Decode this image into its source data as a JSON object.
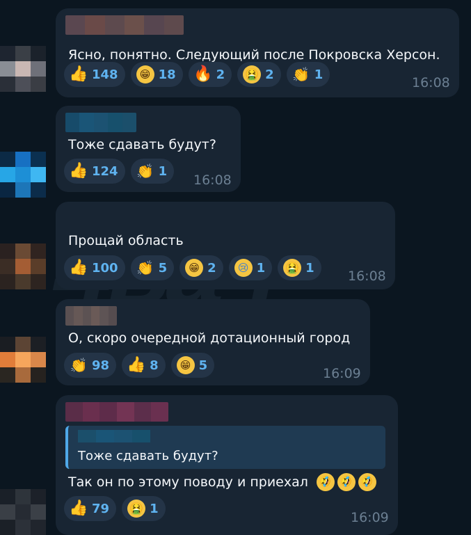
{
  "watermark": "4вач",
  "messages": [
    {
      "text": "Ясно, понятно. Следующий после Покровска Херсон.",
      "time": "16:08",
      "sender_colors": [
        "#5a4750",
        "#6a4a48",
        "#5d4a4e",
        "#6b504b",
        "#574650",
        "#5e4a4d"
      ],
      "avatar_colors": [
        "#1e2530",
        "#3a3f46",
        "#1b222b",
        "#8a8e95",
        "#c9b7b3",
        "#6e7079",
        "#2a2f38",
        "#4d4f58",
        "#3a3d44"
      ],
      "reactions": [
        {
          "icon": "thumbs-up-icon",
          "kind": "thumb",
          "count": "148"
        },
        {
          "icon": "grin-icon",
          "kind": "grin",
          "count": "18"
        },
        {
          "icon": "fire-icon",
          "kind": "fire",
          "count": "2"
        },
        {
          "icon": "vomit-icon",
          "kind": "vomit",
          "count": "2"
        },
        {
          "icon": "clap-icon",
          "kind": "clap",
          "count": "1"
        }
      ]
    },
    {
      "text": "Тоже сдавать будут?",
      "time": "16:08",
      "sender_colors": [
        "#174b6a",
        "#1a5577",
        "#1c5272",
        "#17506c",
        "#1b4f6b"
      ],
      "avatar_colors": [
        "#0c2a45",
        "#1770c2",
        "#0b3050",
        "#27a6e6",
        "#1d8fd6",
        "#3fb7f2",
        "#0a2642",
        "#1d76b8",
        "#0c2c4a"
      ],
      "reactions": [
        {
          "icon": "thumbs-up-icon",
          "kind": "thumb",
          "count": "124"
        },
        {
          "icon": "clap-icon",
          "kind": "clap",
          "count": "1"
        }
      ]
    },
    {
      "text": "Прощай область",
      "time": "16:08",
      "sender_colors": [],
      "avatar_colors": [
        "#2a2120",
        "#6a4a34",
        "#302420",
        "#3b2d25",
        "#a45d34",
        "#5a3d29",
        "#2b2320",
        "#4a3a2c",
        "#2d2420"
      ],
      "reactions": [
        {
          "icon": "thumbs-up-icon",
          "kind": "thumb",
          "count": "100"
        },
        {
          "icon": "clap-icon",
          "kind": "clap",
          "count": "5"
        },
        {
          "icon": "grin-icon",
          "kind": "grin",
          "count": "2"
        },
        {
          "icon": "cry-icon",
          "kind": "cry",
          "count": "1"
        },
        {
          "icon": "vomit-icon",
          "kind": "vomit",
          "count": "1"
        }
      ]
    },
    {
      "text": "О, скоро очередной дотационный город",
      "time": "16:09",
      "sender_colors": [
        "#5a5052",
        "#665856",
        "#5c5253",
        "#6a5a57",
        "#5e5455",
        "#554c4f"
      ],
      "avatar_colors": [
        "#1a1d22",
        "#5c4434",
        "#1c1f24",
        "#e07d3a",
        "#f6a65c",
        "#d9874a",
        "#2a2621",
        "#a86a3c",
        "#26221f"
      ],
      "reactions": [
        {
          "icon": "clap-icon",
          "kind": "clap",
          "count": "98"
        },
        {
          "icon": "thumbs-up-icon",
          "kind": "thumb",
          "count": "8"
        },
        {
          "icon": "grin-icon",
          "kind": "grin",
          "count": "5"
        }
      ]
    },
    {
      "text": "Так он по этому поводу и приехал",
      "time": "16:09",
      "sender_colors": [
        "#5a2d48",
        "#6a2f4e",
        "#5e2c4a",
        "#733454",
        "#5c2e4b",
        "#6a3050"
      ],
      "avatar_colors": [
        "#1a2028",
        "#2e343b",
        "#1c2129",
        "#3a3f46",
        "#262b33",
        "#3b4047",
        "#1b2027",
        "#2c3139",
        "#20252d"
      ],
      "emoji_suffix": [
        "rofl-icon",
        "rofl-icon",
        "rofl-icon"
      ],
      "reply": {
        "text": "Тоже сдавать будут?",
        "name_colors": [
          "#1b4f6b",
          "#1a5577",
          "#1c5272",
          "#17506c"
        ]
      },
      "reactions": [
        {
          "icon": "thumbs-up-icon",
          "kind": "thumb",
          "count": "79"
        },
        {
          "icon": "vomit-icon",
          "kind": "vomit",
          "count": "1"
        }
      ]
    }
  ],
  "icon_glyphs": {
    "thumb": "👍",
    "grin": "😁",
    "fire": "🔥",
    "vomit": "🤮",
    "clap": "👏",
    "cry": "😢",
    "rofl": "🤣"
  }
}
